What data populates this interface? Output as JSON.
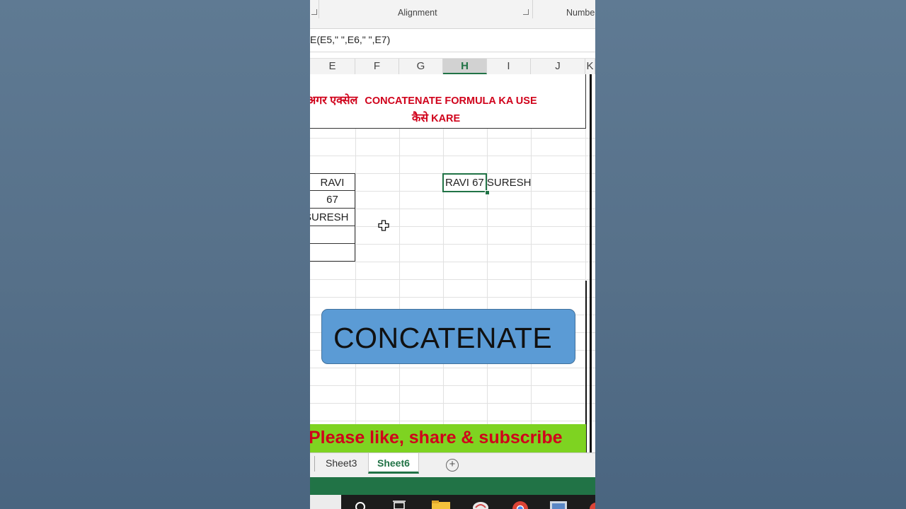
{
  "ribbon": {
    "alignment_label": "Alignment",
    "number_label": "Numbe"
  },
  "formula_bar": {
    "text": "E(E5,\" \",E6,\" \",E7)"
  },
  "columns": [
    "E",
    "F",
    "G",
    "H",
    "I",
    "J",
    "K"
  ],
  "active_column": "H",
  "title": {
    "line1_hindi": "अगर एक्सेल",
    "line1_english": "CONCATENATE FORMULA KA USE",
    "line2_hindi": "कैसे",
    "line2_english": "KARE"
  },
  "table": {
    "cells": [
      "RAVI",
      "67",
      "SURESH",
      "",
      ""
    ]
  },
  "result": {
    "text": "RAVI 67 SURESH"
  },
  "banner": {
    "text": "CONCATENATE"
  },
  "subscribe": {
    "text": "Please like, share & subscribe"
  },
  "sheets": {
    "tabs": [
      "Sheet3",
      "Sheet6"
    ],
    "active": "Sheet6"
  },
  "colors": {
    "excel_green": "#217346",
    "banner_blue": "#5b9bd5",
    "title_red": "#d0021b",
    "subscribe_green": "#7ed321"
  }
}
